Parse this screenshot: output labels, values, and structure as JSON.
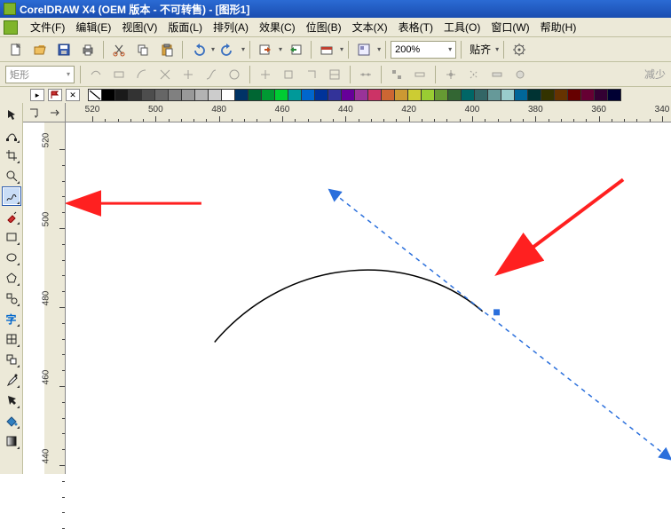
{
  "title": "CorelDRAW X4 (OEM 版本 - 不可转售) - [图形1]",
  "menu": {
    "items": [
      "文件(F)",
      "编辑(E)",
      "视图(V)",
      "版面(L)",
      "排列(A)",
      "效果(C)",
      "位图(B)",
      "文本(X)",
      "表格(T)",
      "工具(O)",
      "窗口(W)",
      "帮助(H)"
    ]
  },
  "toolbar": {
    "zoom_value": "200%",
    "snap_label": "贴齐",
    "arrow_glyph": "▾"
  },
  "propbar": {
    "shape_label": "矩形",
    "tail": "减少"
  },
  "ruler": {
    "top": [
      "520",
      "500",
      "480",
      "460",
      "440",
      "420",
      "400",
      "380",
      "360",
      "340"
    ],
    "left": [
      "520",
      "500",
      "480",
      "460",
      "440"
    ]
  },
  "palette": {
    "colors": [
      "#000000",
      "#1a1a1a",
      "#333333",
      "#4d4d4d",
      "#666666",
      "#808080",
      "#999999",
      "#b3b3b3",
      "#cccccc",
      "#ffffff",
      "#003366",
      "#006633",
      "#009933",
      "#00cc33",
      "#009999",
      "#0066cc",
      "#003399",
      "#333399",
      "#660099",
      "#993399",
      "#cc3366",
      "#cc6633",
      "#cc9933",
      "#cccc33",
      "#99cc33",
      "#669933",
      "#336633",
      "#006666",
      "#336666",
      "#669999",
      "#99cccc",
      "#006699",
      "#003333",
      "#333300",
      "#663300",
      "#660000",
      "#660033",
      "#330033",
      "#000033"
    ]
  },
  "icons": {
    "new": "new-icon",
    "open": "open-icon",
    "save": "save-icon",
    "print": "print-icon",
    "cut": "cut-icon",
    "copy": "copy-icon",
    "paste": "paste-icon",
    "undo": "undo-icon",
    "redo": "redo-icon",
    "import": "import-icon",
    "export": "export-icon",
    "publish": "publish-icon",
    "options": "options-icon",
    "launcher": "launcher-icon",
    "pick": "pick-tool",
    "shape": "shape-tool",
    "crop": "crop-tool",
    "zoom": "zoom-tool",
    "freehand": "freehand-tool",
    "smartfill": "smartfill-tool",
    "rectangle": "rectangle-tool",
    "ellipse": "ellipse-tool",
    "polygon": "polygon-tool",
    "basicshapes": "basic-shapes-tool",
    "text": "text-tool",
    "table": "table-tool",
    "interactive": "interactive-tool",
    "eyedropper": "eyedropper-tool",
    "outline": "outline-tool",
    "fill": "fill-tool",
    "intfill": "interactive-fill-tool"
  },
  "chart_data": null
}
